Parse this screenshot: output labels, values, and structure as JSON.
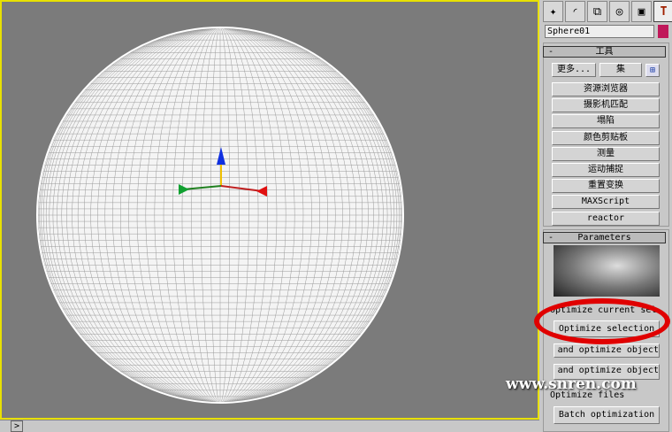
{
  "viewport": {
    "object": "Sphere01",
    "nav_marker": ">"
  },
  "command_panel": {
    "tabs": [
      {
        "icon": "create-icon"
      },
      {
        "icon": "modify-icon"
      },
      {
        "icon": "hierarchy-icon"
      },
      {
        "icon": "motion-icon"
      },
      {
        "icon": "display-icon"
      },
      {
        "icon": "utilities-icon"
      }
    ],
    "object_name": "Sphere01",
    "object_color": "#c0185a",
    "tools_rollout": {
      "toggle": "-",
      "title": "工具",
      "more": "更多...",
      "sets": "集",
      "buttons": [
        "资源浏览器",
        "摄影机匹配",
        "塌陷",
        "颜色剪贴板",
        "测量",
        "运动捕捉",
        "重置变换",
        "MAXScript",
        "reactor"
      ]
    },
    "parameters_rollout": {
      "toggle": "-",
      "title": "Parameters",
      "group1": "Optimize current sel",
      "optimize_selection": "Optimize selection",
      "pick_optimize": "Pick and optimize object",
      "select_optimize": "Select and optimize object",
      "group2": "Optimize files",
      "batch": "Batch optimization"
    }
  },
  "watermark": "www.snren.com"
}
